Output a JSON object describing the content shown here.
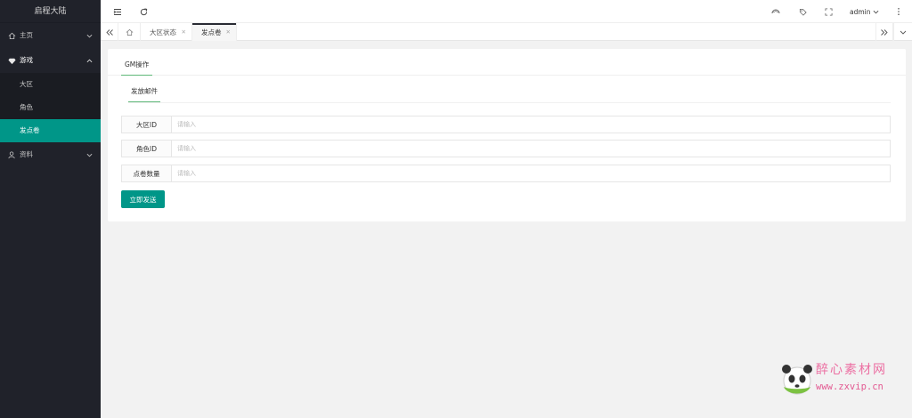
{
  "app": {
    "title": "启程大陆"
  },
  "sidebar": {
    "items": [
      {
        "label": "主页",
        "icon": "home-icon"
      },
      {
        "label": "游戏",
        "icon": "diamond-icon"
      },
      {
        "label": "资料",
        "icon": "user-icon"
      }
    ],
    "game_sub": [
      {
        "label": "大区"
      },
      {
        "label": "角色"
      },
      {
        "label": "发点卷"
      }
    ]
  },
  "header": {
    "user": "admin"
  },
  "tabs": [
    {
      "label": "大区状态"
    },
    {
      "label": "发点卷"
    }
  ],
  "card": {
    "tab": "GM操作",
    "section_title": "发放邮件",
    "fields": [
      {
        "label": "大区ID",
        "placeholder": "请输入"
      },
      {
        "label": "角色ID",
        "placeholder": "请输入"
      },
      {
        "label": "点卷数量",
        "placeholder": "请输入"
      }
    ],
    "submit_label": "立即发送"
  },
  "watermark": {
    "title": "醉心素材网",
    "url": "www.zxvip.cn"
  },
  "colors": {
    "accent": "#009688",
    "sidebar_bg": "#20222a",
    "tab_underline": "#5fb878"
  }
}
